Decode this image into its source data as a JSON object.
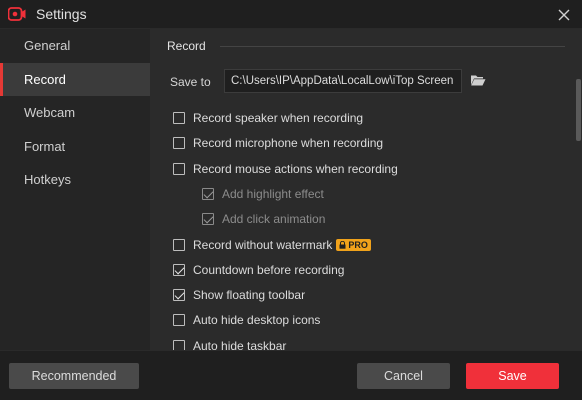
{
  "window": {
    "title": "Settings",
    "app_icon": "itop-record-icon",
    "close_icon": "close-icon"
  },
  "sidebar": {
    "items": [
      {
        "label": "General",
        "active": false
      },
      {
        "label": "Record",
        "active": true
      },
      {
        "label": "Webcam",
        "active": false
      },
      {
        "label": "Format",
        "active": false
      },
      {
        "label": "Hotkeys",
        "active": false
      }
    ]
  },
  "record": {
    "section_title": "Record",
    "save_to_label": "Save to",
    "save_path": "C:\\Users\\IP\\AppData\\LocalLow\\iTop Screen",
    "folder_icon": "folder-open-icon",
    "options": [
      {
        "label": "Record speaker when recording",
        "checked": false,
        "indent": false,
        "disabled": false
      },
      {
        "label": "Record microphone when recording",
        "checked": false,
        "indent": false,
        "disabled": false
      },
      {
        "label": "Record mouse actions when recording",
        "checked": false,
        "indent": false,
        "disabled": false
      },
      {
        "label": "Add highlight effect",
        "checked": true,
        "indent": true,
        "disabled": true
      },
      {
        "label": "Add click animation",
        "checked": true,
        "indent": true,
        "disabled": true
      },
      {
        "label": "Record without watermark",
        "checked": false,
        "indent": false,
        "disabled": false,
        "badge": "PRO"
      },
      {
        "label": "Countdown before recording",
        "checked": true,
        "indent": false,
        "disabled": false
      },
      {
        "label": "Show floating toolbar",
        "checked": true,
        "indent": false,
        "disabled": false
      },
      {
        "label": "Auto hide desktop icons",
        "checked": false,
        "indent": false,
        "disabled": false
      },
      {
        "label": "Auto hide taskbar",
        "checked": false,
        "indent": false,
        "disabled": false
      }
    ]
  },
  "footer": {
    "recommended_label": "Recommended",
    "cancel_label": "Cancel",
    "save_label": "Save"
  },
  "colors": {
    "accent": "#f0303a",
    "pro_badge": "#f0a21b",
    "background": "#1f1f1f",
    "panel": "#2b2b2b"
  }
}
